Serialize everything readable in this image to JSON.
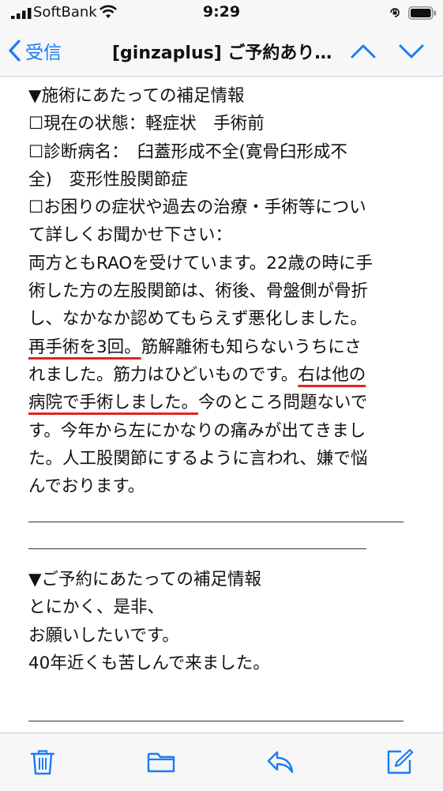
{
  "status_bar": {
    "carrier": "SoftBank",
    "time": "9:29",
    "icons": [
      "signal-bars-icon",
      "wifi-icon",
      "orientation-lock-icon",
      "battery-icon"
    ]
  },
  "nav": {
    "back_label": "受信",
    "title": "[ginzaplus] ご予約あり…",
    "icons": [
      "chevron-left-icon",
      "chevron-up-icon",
      "chevron-down-icon"
    ]
  },
  "email": {
    "lines": [
      "▼施術にあたっての補足情報",
      "☐現在の状態：軽症状　手術前",
      "☐診断病名：　臼蓋形成不全(寛骨臼形成不",
      "全)　変形性股関節症",
      "☐お困りの症状や過去の治療・手術等につい",
      "て詳しくお聞かせ下さい：",
      "両方ともRAOを受けています。22歳の時に手",
      "術した方の左股関節は、術後、骨盤側が骨折",
      "し、なかなか認めてもらえず悪化しました。"
    ],
    "line10_highlight": "再手術を3回。",
    "line10_rest": "筋解離術も知らないうちにさ",
    "line11_plain": "れました。筋力はひどいものです。",
    "line11_highlight": "右は他の",
    "line12_highlight": "病院で手術しました。",
    "line12_rest": "今のところ問題ないで",
    "lines_after": [
      "す。今年から左にかなりの痛みが出てきまし",
      "た。人工股関節にするように言われ、嫌で悩",
      "んでおります。"
    ],
    "section2_heading": "▼ご予約にあたっての補足情報",
    "section2_lines": [
      "とにかく、是非、",
      "お願いしたいです。",
      "40年近くも苦しんで来ました。"
    ],
    "highlight_color": "#e0241f"
  },
  "toolbar": {
    "icons": [
      "trash-icon",
      "folder-icon",
      "reply-icon",
      "compose-icon"
    ],
    "accent": "#1b7cf5"
  }
}
